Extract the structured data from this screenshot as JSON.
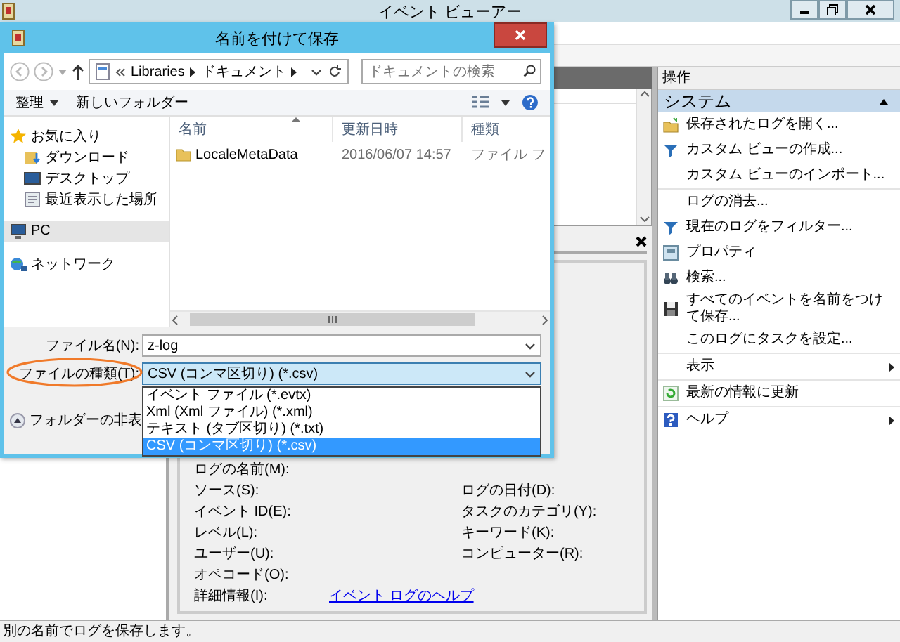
{
  "window": {
    "title": "イベント ビューアー"
  },
  "actions": {
    "title": "操作",
    "section": "システム",
    "items": [
      {
        "label": "保存されたログを開く...",
        "separator_before": false,
        "submenu": false
      },
      {
        "label": "カスタム ビューの作成...",
        "separator_before": false,
        "submenu": false
      },
      {
        "label": "カスタム ビューのインポート...",
        "separator_before": false,
        "submenu": false
      },
      {
        "label": "ログの消去...",
        "separator_before": true,
        "submenu": false
      },
      {
        "label": "現在のログをフィルター...",
        "separator_before": false,
        "submenu": false
      },
      {
        "label": "プロパティ",
        "separator_before": false,
        "submenu": false
      },
      {
        "label": "検索...",
        "separator_before": false,
        "submenu": false
      },
      {
        "label": "すべてのイベントを名前をつけて保存...",
        "separator_before": false,
        "submenu": false
      },
      {
        "label": "このログにタスクを設定...",
        "separator_before": false,
        "submenu": false
      },
      {
        "label": "表示",
        "separator_before": true,
        "submenu": true
      },
      {
        "label": "最新の情報に更新",
        "separator_before": true,
        "submenu": false
      },
      {
        "label": "ヘルプ",
        "separator_before": true,
        "submenu": true
      }
    ]
  },
  "details": {
    "rows": [
      {
        "label": "ログの名前(M):"
      },
      {
        "label": "ソース(S):",
        "right_label": "ログの日付(D):"
      },
      {
        "label": "イベント ID(E):",
        "right_label": "タスクのカテゴリ(Y):"
      },
      {
        "label": "レベル(L):",
        "right_label": "キーワード(K):"
      },
      {
        "label": "ユーザー(U):",
        "right_label": "コンピューター(R):"
      },
      {
        "label": "オペコード(O):"
      },
      {
        "label": "詳細情報(I):",
        "link": "イベント ログのヘルプ"
      }
    ]
  },
  "status_bar": {
    "text": "別の名前でログを保存します。"
  },
  "dialog": {
    "title": "名前を付けて保存",
    "breadcrumbs": [
      "Libraries",
      "ドキュメント"
    ],
    "search": {
      "placeholder": "ドキュメントの検索"
    },
    "toolbar": [
      {
        "label": "整理",
        "dropdown": true
      },
      {
        "label": "新しいフォルダー",
        "dropdown": false
      }
    ],
    "navigation": [
      {
        "label": "お気に入り",
        "selected": false,
        "children": [
          {
            "label": "ダウンロード",
            "selected": false
          },
          {
            "label": "デスクトップ",
            "selected": false
          },
          {
            "label": "最近表示した場所",
            "selected": false
          }
        ]
      },
      {
        "label": "PC",
        "selected": true
      },
      {
        "label": "ネットワーク",
        "selected": false
      }
    ],
    "columns": [
      "名前",
      "更新日時",
      "種類"
    ],
    "rows": [
      {
        "name": "LocaleMetaData",
        "modified": "2016/06/07 14:57",
        "type": "ファイル フ"
      }
    ],
    "file_name": {
      "label": "ファイル名(N):",
      "value": "z-log"
    },
    "file_type": {
      "label": "ファイルの種類(T):",
      "value": "CSV (コンマ区切り) (*.csv)",
      "expanded": true,
      "highlighted": true,
      "options": [
        {
          "label": "イベント ファイル (*.evtx)",
          "selected": false
        },
        {
          "label": "Xml (Xml ファイル) (*.xml)",
          "selected": false
        },
        {
          "label": "テキスト (タブ区切り) (*.txt)",
          "selected": false
        },
        {
          "label": "CSV (コンマ区切り) (*.csv)",
          "selected": true
        }
      ]
    },
    "hide_folders": "フォルダーの非表"
  }
}
